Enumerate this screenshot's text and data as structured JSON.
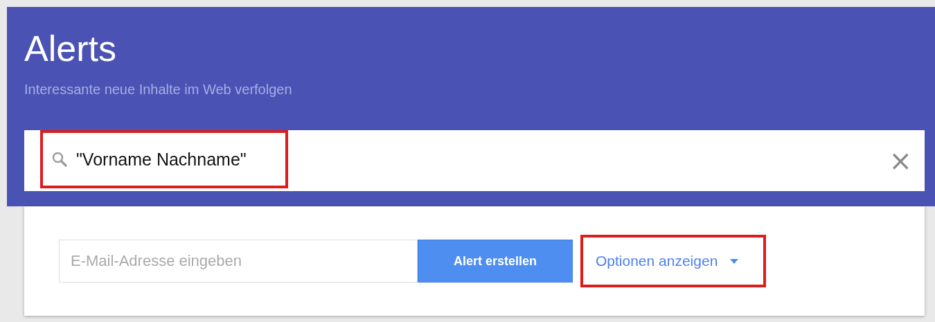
{
  "header": {
    "title": "Alerts",
    "subtitle": "Interessante neue Inhalte im Web verfolgen"
  },
  "search": {
    "value": "\"Vorname Nachname\"",
    "highlighted": true,
    "clear": "×"
  },
  "form": {
    "email_placeholder": "E-Mail-Adresse eingeben",
    "button": "Alert erstellen",
    "options_link": "Optionen anzeigen",
    "options_highlighted": true
  }
}
